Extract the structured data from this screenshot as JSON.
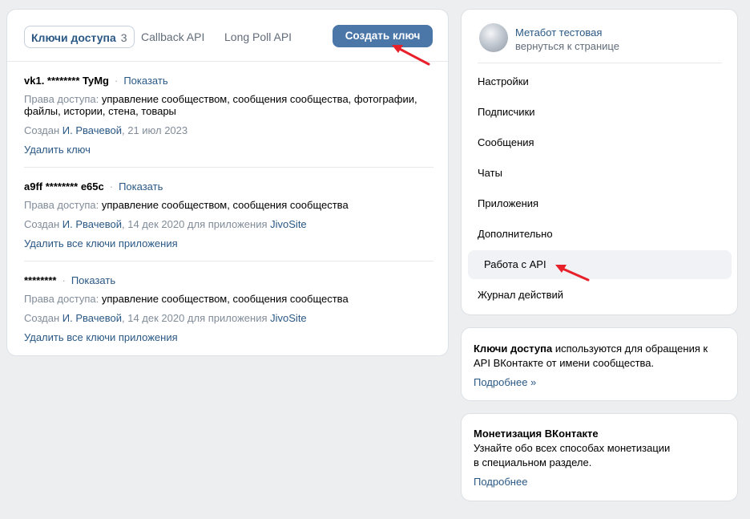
{
  "tabs": {
    "access_keys": {
      "label": "Ключи доступа",
      "count": "3"
    },
    "callback": {
      "label": "Callback API"
    },
    "longpoll": {
      "label": "Long Poll API"
    },
    "create_label": "Создать ключ"
  },
  "keys": [
    {
      "name": "vk1. ******** TyMg",
      "show": "Показать",
      "rights_label": "Права доступа:",
      "rights_line1": "управление сообществом, сообщения сообщества, фотографии,",
      "rights_line2": "файлы, истории, стена, товары",
      "created_prefix": "Создан",
      "creator": "И. Рвачевой",
      "date": ", 21 июл 2023",
      "action": "Удалить ключ"
    },
    {
      "name": "a9ff ******** e65c",
      "show": "Показать",
      "rights_label": "Права доступа:",
      "rights_line1": "управление сообществом, сообщения сообщества",
      "created_prefix": "Создан",
      "creator": "И. Рвачевой",
      "date": ", 14 дек 2020 для приложения",
      "app": "JivoSite",
      "action": "Удалить все ключи приложения"
    },
    {
      "name": "********",
      "show": "Показать",
      "rights_label": "Права доступа:",
      "rights_line1": "управление сообществом, сообщения сообщества",
      "created_prefix": "Создан",
      "creator": "И. Рвачевой",
      "date": ", 14 дек 2020 для приложения",
      "app": "JivoSite",
      "action": "Удалить все ключи приложения"
    }
  ],
  "sidebar": {
    "profile_name": "Метабот тестовая",
    "back_link": "вернуться к странице",
    "items": [
      {
        "label": "Настройки"
      },
      {
        "label": "Подписчики"
      },
      {
        "label": "Сообщения"
      },
      {
        "label": "Чаты"
      },
      {
        "label": "Приложения"
      },
      {
        "label": "Дополнительно"
      },
      {
        "label": "Работа с API"
      },
      {
        "label": "Журнал действий"
      }
    ]
  },
  "info": {
    "bold": "Ключи доступа",
    "text1": " используются для обращения к",
    "text2": "API ВКонтакте от имени сообщества.",
    "more": "Подробнее »"
  },
  "monetization": {
    "title": "Монетизация ВКонтакте",
    "line1": "Узнайте обо всех способах монетизации",
    "line2": "в специальном разделе.",
    "more": "Подробнее"
  },
  "colors": {
    "accent": "#4a76a8",
    "link": "#2a5885",
    "arrow": "#e8202a"
  }
}
